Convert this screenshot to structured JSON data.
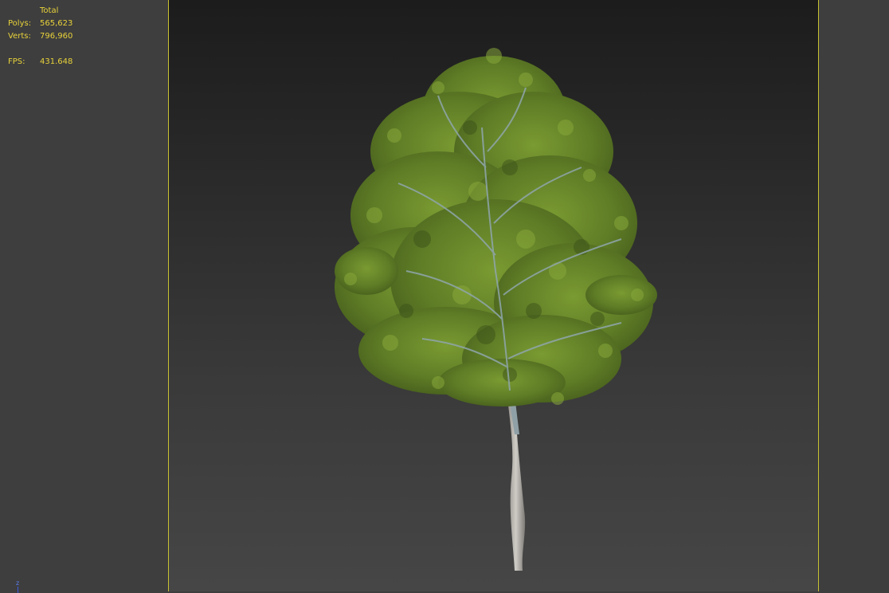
{
  "stats": {
    "header": "Total",
    "polys_label": "Polys:",
    "polys_value": "565,623",
    "verts_label": "Verts:",
    "verts_value": "796,960",
    "fps_label": "FPS:",
    "fps_value": "431.648"
  },
  "axis": {
    "label": "z"
  },
  "colors": {
    "stats_text": "#e8d23a",
    "safe_frame": "#c8c234",
    "foliage": "#6f8a2a",
    "trunk": "#b9b6b0"
  },
  "icons": {
    "axis_tripod": "axis-tripod-icon"
  }
}
